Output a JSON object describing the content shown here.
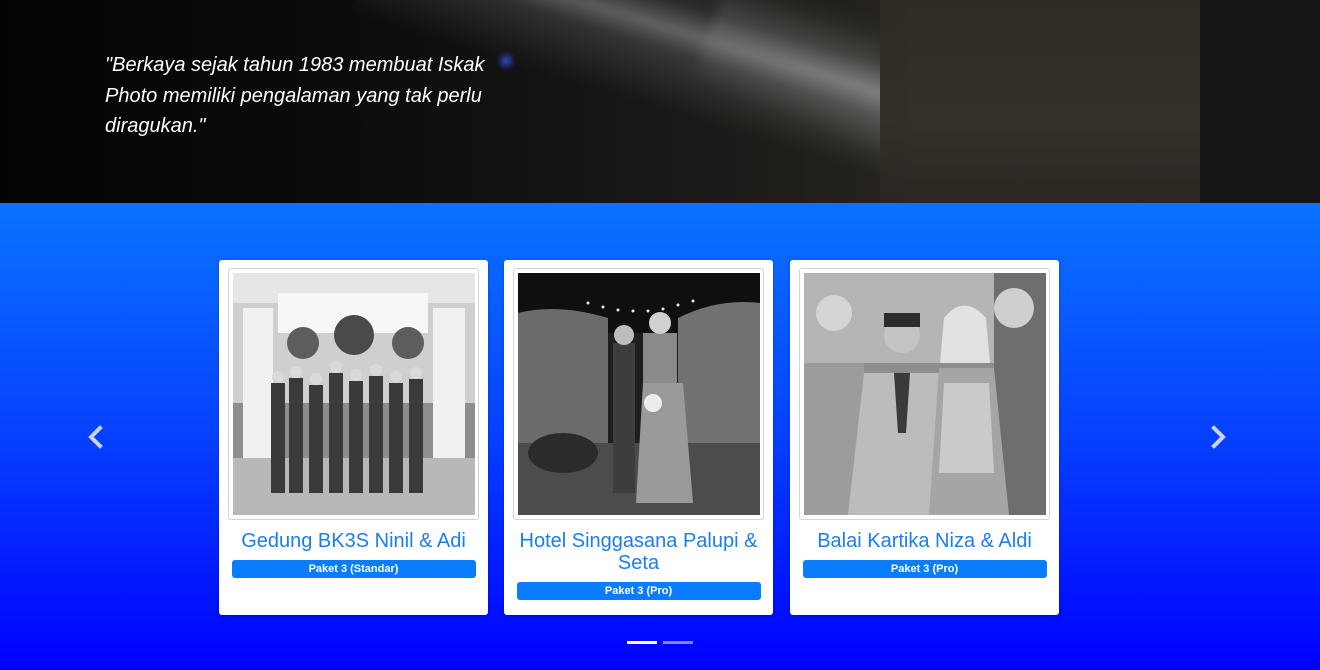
{
  "hero": {
    "quote": "\"Berkaya sejak tahun 1983 membuat Iskak Photo memiliki pengalaman yang tak perlu diragukan.\""
  },
  "carousel": {
    "prev_icon": "chevron-left-icon",
    "next_icon": "chevron-right-icon",
    "items": [
      {
        "title": "Gedung BK3S Ninil & Adi",
        "package": "Paket 3 (Standar)"
      },
      {
        "title": "Hotel Singgasana Palupi & Seta",
        "package": "Paket 3 (Pro)"
      },
      {
        "title": "Balai Kartika Niza & Aldi",
        "package": "Paket 3 (Pro)"
      }
    ],
    "indicators": [
      {
        "active": true
      },
      {
        "active": false
      }
    ]
  },
  "colors": {
    "section_top": "#0a73ff",
    "section_bottom": "#0000ff",
    "caption": "#1a7ef0",
    "badge": "#0a7dff"
  }
}
